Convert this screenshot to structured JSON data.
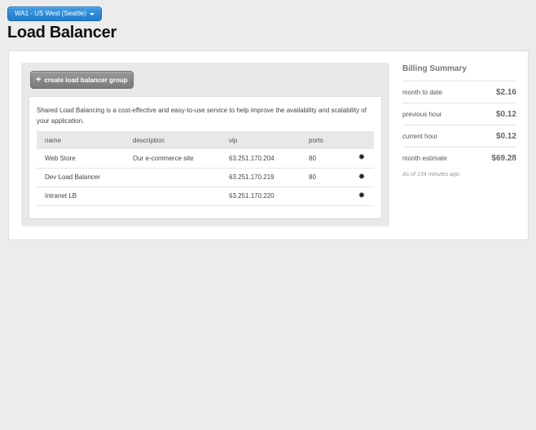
{
  "region": {
    "label": "WA1 - US West (Seattle)"
  },
  "page": {
    "title": "Load Balancer"
  },
  "toolbar": {
    "create_label": "create load balancer group"
  },
  "panel": {
    "description": "Shared Load Balancing is a cost-effective and easy-to-use service to help improve the availability and scalability of your application."
  },
  "table": {
    "columns": {
      "name": "name",
      "description": "description",
      "vip": "vip",
      "ports": "ports"
    },
    "rows": [
      {
        "name": "Web Store",
        "description": "Our e-commerce site",
        "vip": "63.251.170.204",
        "ports": "80"
      },
      {
        "name": "Dev Load Balancer",
        "description": "",
        "vip": "63.251.170.219",
        "ports": "80"
      },
      {
        "name": "Intranet LB",
        "description": "",
        "vip": "63.251.170.220",
        "ports": ""
      }
    ]
  },
  "billing": {
    "title": "Billing Summary",
    "rows": [
      {
        "label": "month to date",
        "value": "$2.16"
      },
      {
        "label": "previous hour",
        "value": "$0.12"
      },
      {
        "label": "current hour",
        "value": "$0.12"
      },
      {
        "label": "month estimate",
        "value": "$69.28"
      }
    ],
    "note": "As of 134 minutes ago."
  },
  "colors": {
    "accent": "#2a8bd8",
    "button_gray": "#8a8a8a"
  },
  "icons": {
    "create": "plus-icon",
    "row_action": "gear-icon",
    "dropdown": "caret-down-icon"
  }
}
